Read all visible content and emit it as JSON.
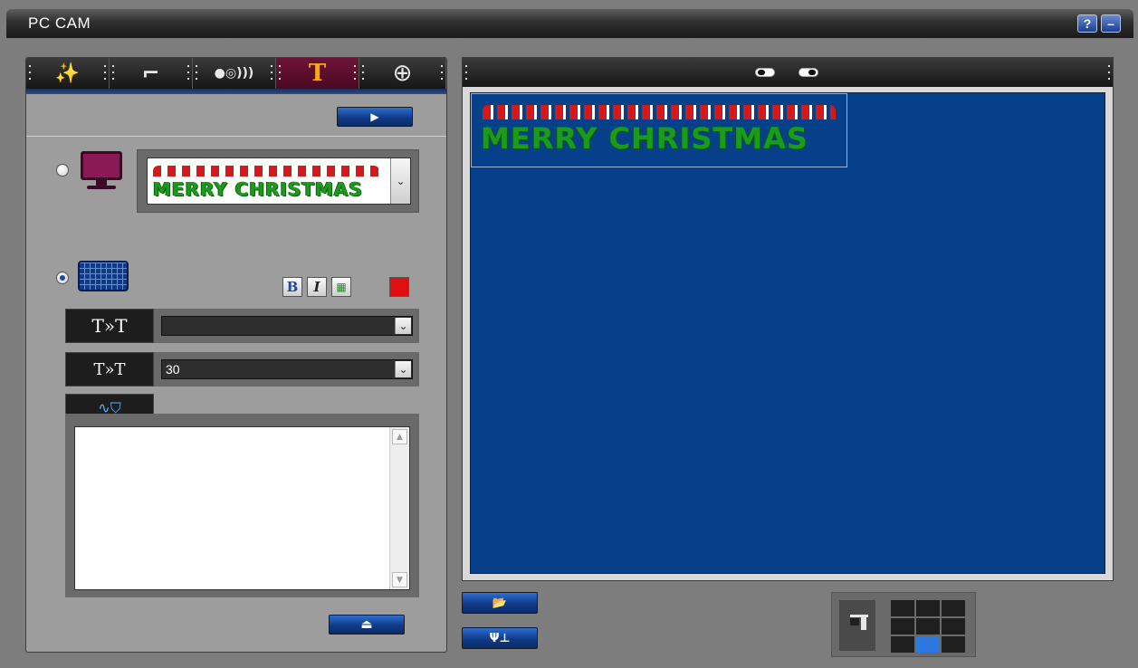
{
  "window": {
    "title": "PC CAM",
    "help_label": "?",
    "minimize_label": "–"
  },
  "tabs": [
    {
      "name": "sparkle-effect",
      "glyph": "✨"
    },
    {
      "name": "frame",
      "glyph": "⌐"
    },
    {
      "name": "toggle-effect",
      "glyph": "●◎)))"
    },
    {
      "name": "text",
      "glyph": "T"
    },
    {
      "name": "zoom",
      "glyph": "⊕"
    }
  ],
  "text_panel": {
    "play_glyph": "▶",
    "banner_text": "MERRY  CHRISTMAS",
    "format": {
      "bold": "B",
      "italic": "I",
      "palette": "▦",
      "color": "#e01010"
    },
    "font_label": "T»T",
    "font_value": "",
    "size_label": "T»T",
    "size_value": "30",
    "effect_label": "∿⛉",
    "text_value": "",
    "apply_glyph": "⏏"
  },
  "preview": {
    "banner_text": "MERRY  CHRISTMAS"
  },
  "bottom": {
    "open_glyph": "📂",
    "settings_glyph": "Ψ⊥"
  },
  "colors": {
    "preview_bg": "#06408a",
    "accent_blue": "#2b78e0",
    "active_tab": "#6e1438"
  }
}
